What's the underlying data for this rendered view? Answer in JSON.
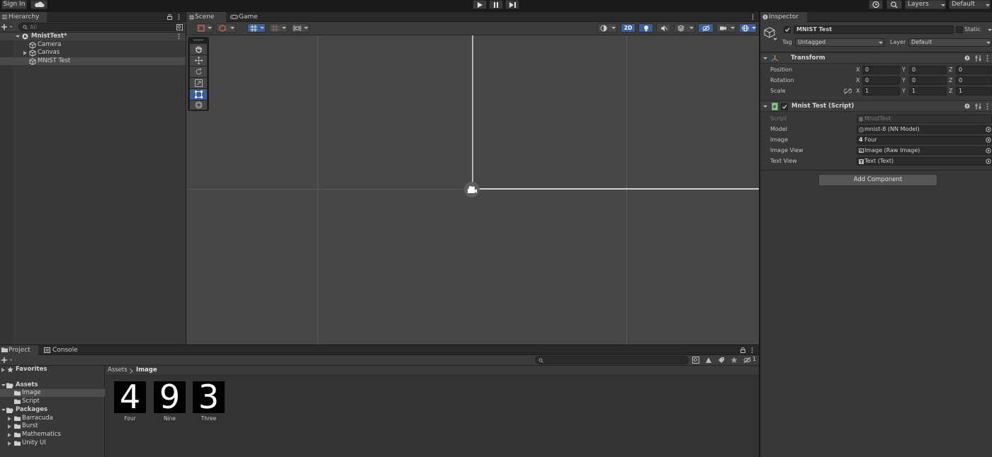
{
  "topbar": {
    "sign_in": "Sign In",
    "layers": "Layers",
    "layout": "Default"
  },
  "hierarchy": {
    "tab": "Hierarchy",
    "search_placeholder": "All",
    "scene_name": "MnistTest*",
    "items": [
      "Camera",
      "Canvas",
      "MNIST Test"
    ]
  },
  "scene": {
    "tabs": [
      "Scene",
      "Game"
    ],
    "mode_2d": "2D"
  },
  "inspector": {
    "tab": "Inspector",
    "object_name": "MNIST Test",
    "static_label": "Static",
    "tag_label": "Tag",
    "tag_value": "Untagged",
    "layer_label": "Layer",
    "layer_value": "Default",
    "transform": {
      "title": "Transform",
      "rows": [
        {
          "label": "Position",
          "x": "0",
          "y": "0",
          "z": "0"
        },
        {
          "label": "Rotation",
          "x": "0",
          "y": "0",
          "z": "0"
        },
        {
          "label": "Scale",
          "x": "1",
          "y": "1",
          "z": "1"
        }
      ],
      "axis_x": "X",
      "axis_y": "Y",
      "axis_z": "Z"
    },
    "script_component": {
      "title": "Mnist Test (Script)",
      "rows": [
        {
          "label": "Script",
          "value": "MnistTest"
        },
        {
          "label": "Model",
          "value": "mnist-8 (NN Model)"
        },
        {
          "label": "Image",
          "value": "Four"
        },
        {
          "label": "Image View",
          "value": "Image (Raw Image)"
        },
        {
          "label": "Text View",
          "value": "Text (Text)"
        }
      ]
    },
    "add_component": "Add Component"
  },
  "project": {
    "tabs": [
      "Project",
      "Console"
    ],
    "hidden_count": "1",
    "favorites": "Favorites",
    "tree": {
      "assets": "Assets",
      "asset_children": [
        "Image",
        "Script"
      ],
      "packages": "Packages",
      "package_children": [
        "Barracuda",
        "Burst",
        "Mathematics",
        "Unity UI"
      ]
    },
    "breadcrumb": [
      "Assets",
      "Image"
    ],
    "assets": [
      {
        "name": "Four",
        "glyph": "4"
      },
      {
        "name": "Nine",
        "glyph": "9"
      },
      {
        "name": "Three",
        "glyph": "3"
      }
    ]
  },
  "colors": {
    "accent": "#3e5f96",
    "panel": "#383838",
    "scene_bg": "#474747",
    "selection": "#4d4d4d"
  }
}
